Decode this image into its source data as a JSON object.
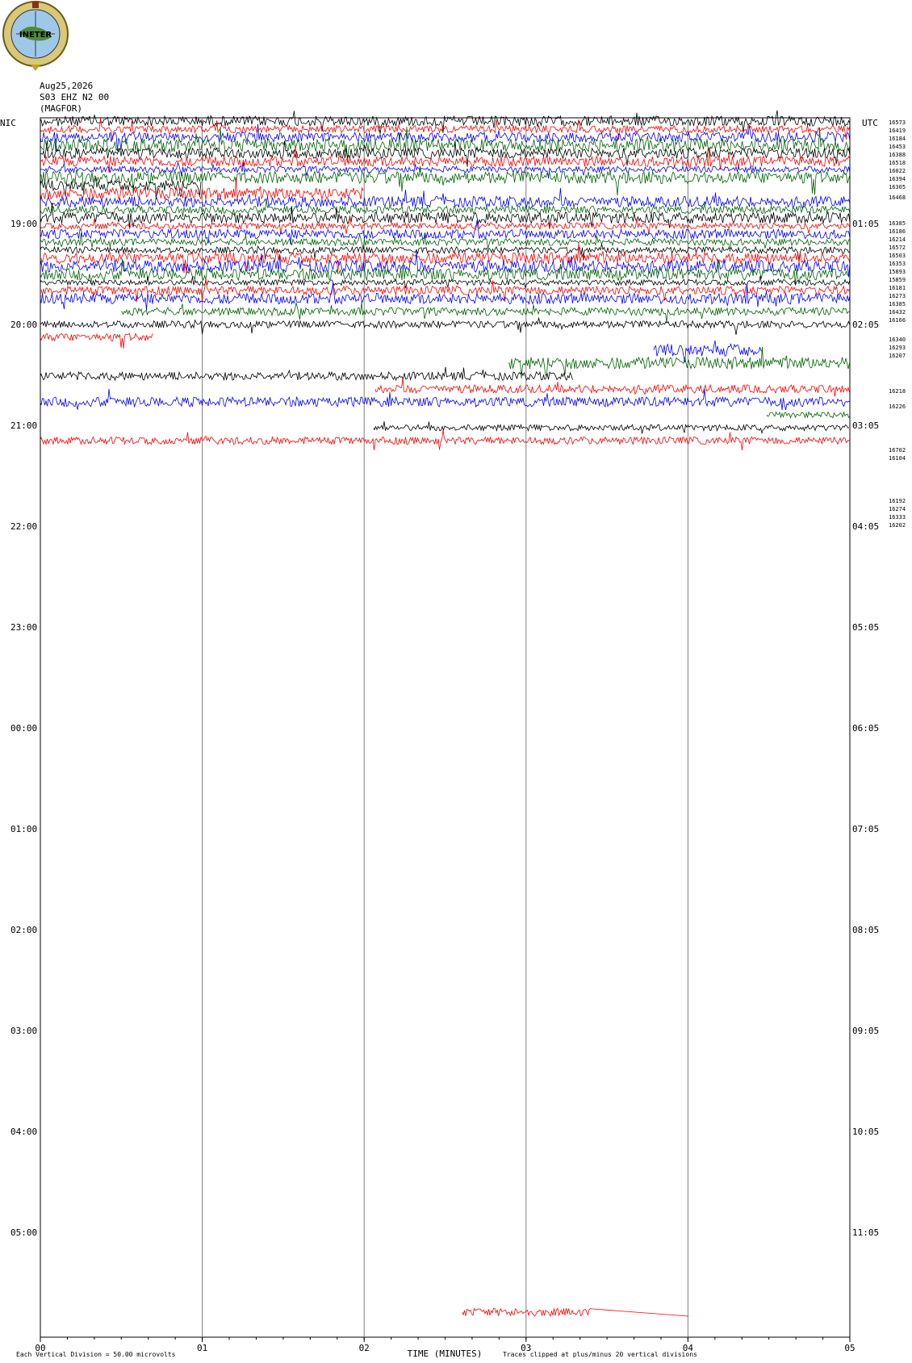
{
  "logo": {
    "text": "INETER"
  },
  "header": {
    "date": "Aug25,2026",
    "station": "S03 EHZ N2 00",
    "network": "(MAGFOR)"
  },
  "left_tz": "NIC",
  "right_tz": "UTC",
  "colors": {
    "trace": [
      "#000000",
      "#ff0000",
      "#0000ff",
      "#006400"
    ],
    "grid": "#808080"
  },
  "chart_data": {
    "type": "line",
    "title": "",
    "xlabel": "TIME (MINUTES)",
    "xlim": [
      0,
      5
    ],
    "x_ticks": [
      "00",
      "01",
      "02",
      "03",
      "04",
      "05"
    ],
    "left_time_labels": [
      "19:00",
      "20:00",
      "21:00",
      "22:00",
      "23:00",
      "00:00",
      "01:00",
      "02:00",
      "03:00",
      "04:00",
      "05:00"
    ],
    "right_time_labels": [
      "01:05",
      "02:05",
      "03:05",
      "04:05",
      "05:05",
      "06:05",
      "07:05",
      "08:05",
      "09:05",
      "10:05",
      "11:05"
    ],
    "row_counts": [
      "16573",
      "16419",
      "16184",
      "16453",
      "16388",
      "16518",
      "16022",
      "16394",
      "16305",
      "16468",
      "16385",
      "16186",
      "16214",
      "16572",
      "16503",
      "16353",
      "15893",
      "15859",
      "16181",
      "16273",
      "16385",
      "16432",
      "16166",
      "16340",
      "16293",
      "16207",
      "16218",
      "16226",
      "16702",
      "16104",
      "16192",
      "16274",
      "16333",
      "16202"
    ],
    "footer_left": "Each Vertical Division =   50.00 microvolts",
    "footer_right": "Traces clipped at plus/minus 20 vertical divisions"
  }
}
